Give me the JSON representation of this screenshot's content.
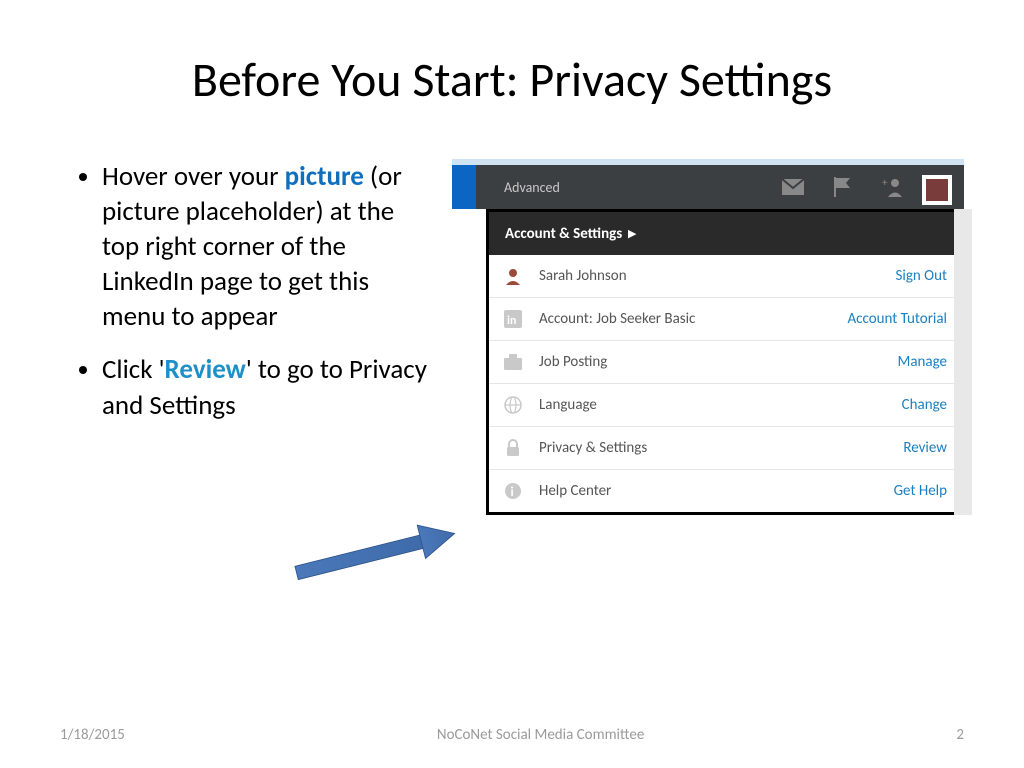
{
  "title": "Before You Start: Privacy Settings",
  "bullets": {
    "b1_pre": "Hover over your ",
    "b1_hl": "picture",
    "b1_post": " (or picture placeholder) at the top right corner of the LinkedIn page to get this menu to appear",
    "b2_pre": "Click '",
    "b2_hl": "Review",
    "b2_post": "' to go to Privacy and Settings"
  },
  "nav": {
    "advanced": "Advanced"
  },
  "dropdown": {
    "header": "Account & Settings",
    "rows": [
      {
        "label": "Sarah Johnson",
        "action": "Sign Out"
      },
      {
        "label": "Account: Job Seeker Basic",
        "action": "Account Tutorial"
      },
      {
        "label": "Job Posting",
        "action": "Manage"
      },
      {
        "label": "Language",
        "action": "Change"
      },
      {
        "label": "Privacy & Settings",
        "action": "Review"
      },
      {
        "label": "Help Center",
        "action": "Get Help"
      }
    ]
  },
  "footer": {
    "date": "1/18/2015",
    "org": "NoCoNet Social Media Committee",
    "page": "2"
  }
}
